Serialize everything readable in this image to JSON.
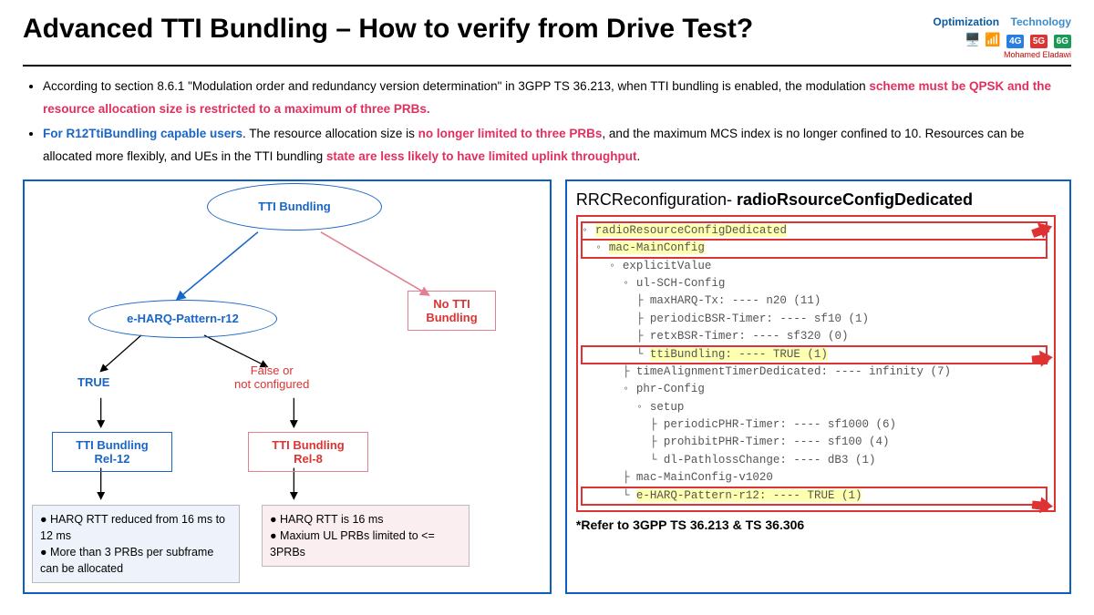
{
  "header": {
    "title": "Advanced TTI Bundling – How to verify from Drive Test?",
    "badge_opt": "Optimization",
    "badge_tech": "Technology",
    "tag_4g": "4G",
    "tag_5g": "5G",
    "tag_6g": "6G",
    "author": "Mohamed Eladawi"
  },
  "bullets": {
    "b1_a": "According to section 8.6.1 \"Modulation order and redundancy version determination\" in 3GPP TS 36.213, when TTI bundling is enabled, the modulation ",
    "b1_red1": "scheme must be QPSK and the resource allocation size is restricted to a maximum of three PRBs.",
    "b2_blue": "For R12TtiBundling capable users",
    "b2_mid1": ". The resource allocation size is ",
    "b2_red1": "no longer limited to three PRBs",
    "b2_mid2": ", and the maximum MCS index is no longer confined to 10. Resources can be allocated more flexibly, and UEs in the TTI bundling ",
    "b2_red2": "state are less likely to have limited uplink throughput",
    "b2_end": "."
  },
  "diagram": {
    "root": "TTI Bundling",
    "eharq": "e-HARQ-Pattern-r12",
    "no_tti": "No TTI\nBundling",
    "true_lbl": "TRUE",
    "false_lbl": "False or\nnot configured",
    "rel12": "TTI Bundling\nRel-12",
    "rel8": "TTI Bundling\nRel-8",
    "note12_a": "HARQ RTT reduced from 16 ms to 12 ms",
    "note12_b": "More than 3 PRBs per subframe can be allocated",
    "note8_a": "HARQ RTT is 16 ms",
    "note8_b": "Maxium UL PRBs limited to <= 3PRBs"
  },
  "right": {
    "title_a": "RRCReconfiguration- ",
    "title_b": "radioRsourceConfigDedicated",
    "l1": "radioResourceConfigDedicated",
    "l2": "mac-MainConfig",
    "l3": "explicitValue",
    "l4": "ul-SCH-Config",
    "l5": "maxHARQ-Tx: ---- n20 (11)",
    "l6": "periodicBSR-Timer: ---- sf10 (1)",
    "l7": "retxBSR-Timer: ---- sf320 (0)",
    "l8": "ttiBundling: ---- TRUE (1)",
    "l9": "timeAlignmentTimerDedicated: ---- infinity (7)",
    "l10": "phr-Config",
    "l11": "setup",
    "l12": "periodicPHR-Timer: ---- sf1000 (6)",
    "l13": "prohibitPHR-Timer: ---- sf100 (4)",
    "l14": "dl-PathlossChange: ---- dB3 (1)",
    "l15": "mac-MainConfig-v1020",
    "l16": "e-HARQ-Pattern-r12: ---- TRUE (1)",
    "foot": "*Refer to 3GPP TS 36.213 & TS 36.306"
  }
}
